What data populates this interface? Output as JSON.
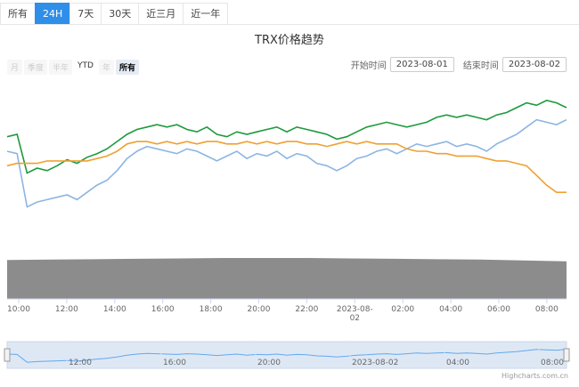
{
  "tabs": [
    "所有",
    "24H",
    "7天",
    "30天",
    "近三月",
    "近一年"
  ],
  "active_tab": "24H",
  "title": "TRX价格趋势",
  "range_selector": [
    "月",
    "季度",
    "半年",
    "YTD",
    "年",
    "所有"
  ],
  "range_selected": "所有",
  "start_label": "开始时间",
  "start_date": "2023-08-01",
  "end_label": "结束时间",
  "end_date": "2023-08-02",
  "credit": "Highcharts.com.cn",
  "colors": {
    "green": "#1e9a3c",
    "blue": "#8db5e2",
    "orange": "#f0a030",
    "volume": "#8c8c8c",
    "navigator": "#c8d8ee",
    "accent": "#2f8ee8"
  },
  "chart_data": {
    "type": "line",
    "x_ticks": [
      "10:00",
      "12:00",
      "14:00",
      "16:00",
      "18:00",
      "20:00",
      "22:00",
      "2023-08-02",
      "02:00",
      "04:00",
      "06:00",
      "08:00"
    ],
    "navigator_ticks": [
      "12:00",
      "16:00",
      "20:00",
      "2023-08-02",
      "04:00",
      "08:00"
    ],
    "series": [
      {
        "color": "green",
        "values": [
          0.62,
          0.64,
          0.32,
          0.36,
          0.34,
          0.38,
          0.43,
          0.4,
          0.45,
          0.48,
          0.52,
          0.58,
          0.64,
          0.68,
          0.7,
          0.72,
          0.7,
          0.72,
          0.68,
          0.66,
          0.7,
          0.64,
          0.62,
          0.66,
          0.64,
          0.66,
          0.68,
          0.7,
          0.66,
          0.7,
          0.68,
          0.66,
          0.64,
          0.6,
          0.62,
          0.66,
          0.7,
          0.72,
          0.74,
          0.72,
          0.7,
          0.72,
          0.74,
          0.78,
          0.8,
          0.78,
          0.8,
          0.78,
          0.76,
          0.8,
          0.82,
          0.86,
          0.9,
          0.88,
          0.92,
          0.9,
          0.86
        ]
      },
      {
        "color": "blue",
        "values": [
          0.5,
          0.48,
          0.04,
          0.08,
          0.1,
          0.12,
          0.14,
          0.1,
          0.16,
          0.22,
          0.26,
          0.34,
          0.44,
          0.5,
          0.54,
          0.52,
          0.5,
          0.48,
          0.52,
          0.5,
          0.46,
          0.42,
          0.46,
          0.5,
          0.44,
          0.48,
          0.46,
          0.5,
          0.44,
          0.48,
          0.46,
          0.4,
          0.38,
          0.34,
          0.38,
          0.44,
          0.46,
          0.5,
          0.52,
          0.48,
          0.52,
          0.56,
          0.54,
          0.56,
          0.58,
          0.54,
          0.56,
          0.54,
          0.5,
          0.56,
          0.6,
          0.64,
          0.7,
          0.76,
          0.74,
          0.72,
          0.76
        ]
      },
      {
        "color": "orange",
        "values": [
          0.38,
          0.4,
          0.4,
          0.4,
          0.42,
          0.42,
          0.42,
          0.42,
          0.42,
          0.44,
          0.46,
          0.5,
          0.56,
          0.58,
          0.58,
          0.56,
          0.58,
          0.56,
          0.58,
          0.56,
          0.58,
          0.58,
          0.56,
          0.56,
          0.58,
          0.56,
          0.58,
          0.56,
          0.58,
          0.58,
          0.56,
          0.56,
          0.54,
          0.56,
          0.58,
          0.56,
          0.58,
          0.56,
          0.56,
          0.56,
          0.52,
          0.5,
          0.5,
          0.48,
          0.48,
          0.46,
          0.46,
          0.46,
          0.44,
          0.42,
          0.42,
          0.4,
          0.38,
          0.3,
          0.22,
          0.16,
          0.16
        ]
      }
    ],
    "volume": {
      "values": [
        0.95,
        0.96,
        0.97,
        0.98,
        0.99,
        1.0,
        1.0,
        1.0,
        0.99,
        0.98,
        0.97,
        0.96,
        0.94,
        0.92
      ]
    }
  }
}
